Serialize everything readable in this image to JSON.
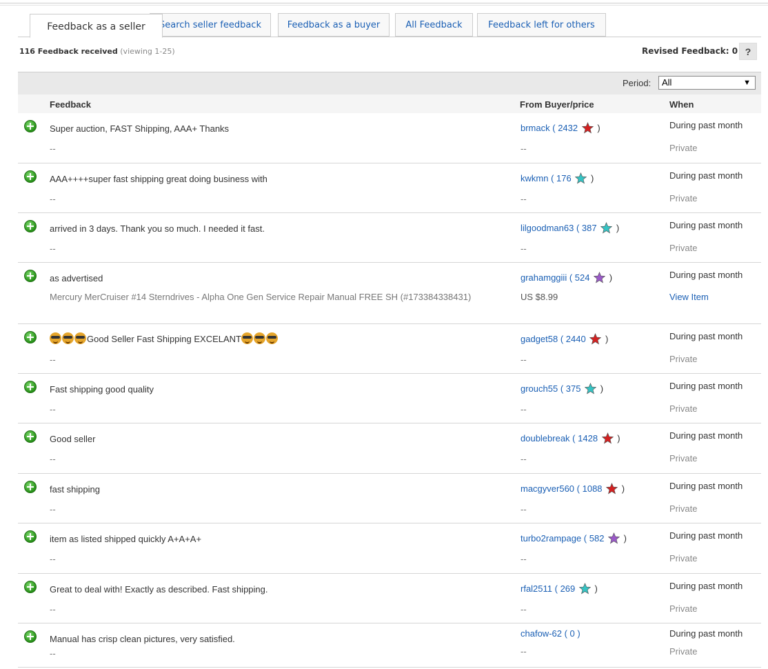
{
  "tabs": [
    {
      "label": "Feedback as a seller"
    },
    {
      "label": "Search seller feedback"
    },
    {
      "label": "Feedback as a buyer"
    },
    {
      "label": "All Feedback"
    },
    {
      "label": "Feedback left for others"
    }
  ],
  "summary": {
    "count_text": "116 Feedback received",
    "viewing_text": "(viewing 1-25)"
  },
  "revised": {
    "label": "Revised Feedback: 0",
    "help": "?"
  },
  "period": {
    "label": "Period:",
    "value": "All"
  },
  "columns": {
    "feedback": "Feedback",
    "from": "From Buyer/price",
    "when": "When"
  },
  "star_colors": {
    "red": "#d42020",
    "teal": "#35c4c4",
    "purple": "#9b59c9"
  },
  "rows": [
    {
      "comment": "Super auction, FAST Shipping, AAA+ Thanks",
      "item": "--",
      "buyer": "brmack",
      "score": "2432",
      "star": "red",
      "price": "--",
      "when": "During past month",
      "status": "Private"
    },
    {
      "comment": "AAA++++super fast shipping great doing business with",
      "item": "--",
      "buyer": "kwkmn",
      "score": "176",
      "star": "teal",
      "price": "--",
      "when": "During past month",
      "status": "Private"
    },
    {
      "comment": "arrived in 3 days. Thank you so much. I needed it fast.",
      "item": "--",
      "buyer": "lilgoodman63",
      "score": "387",
      "star": "teal",
      "price": "--",
      "when": "During past month",
      "status": "Private"
    },
    {
      "comment": "as advertised",
      "item": "Mercury MerCruiser #14 Sterndrives - Alpha One Gen Service Repair Manual FREE SH (#173384338431)",
      "buyer": "grahamggiii",
      "score": "524",
      "star": "purple",
      "price": "US $8.99",
      "when": "During past month",
      "status": "View Item"
    },
    {
      "comment_pre": "",
      "comment": "Good Seller Fast Shipping EXCELANT",
      "item": "--",
      "buyer": "gadget58",
      "score": "2440",
      "star": "red",
      "price": "--",
      "when": "During past month",
      "status": "Private"
    },
    {
      "comment": "Fast shipping good quality",
      "item": "--",
      "buyer": "grouch55",
      "score": "375",
      "star": "teal",
      "price": "--",
      "when": "During past month",
      "status": "Private"
    },
    {
      "comment": "Good seller",
      "item": "--",
      "buyer": "doublebreak",
      "score": "1428",
      "star": "red",
      "price": "--",
      "when": "During past month",
      "status": "Private"
    },
    {
      "comment": "fast shipping",
      "item": "--",
      "buyer": "macgyver560",
      "score": "1088",
      "star": "red",
      "price": "--",
      "when": "During past month",
      "status": "Private"
    },
    {
      "comment": "item as listed shipped quickly A+A+A+",
      "item": "--",
      "buyer": "turbo2rampage",
      "score": "582",
      "star": "purple",
      "price": "--",
      "when": "During past month",
      "status": "Private"
    },
    {
      "comment": "Great to deal with! Exactly as described. Fast shipping.",
      "item": "--",
      "buyer": "rfal2511",
      "score": "269",
      "star": "teal",
      "price": "--",
      "when": "During past month",
      "status": "Private"
    },
    {
      "comment": "Manual has crisp clean pictures, very satisfied.",
      "item": "--",
      "buyer": "chafow-62",
      "score": "0",
      "star": "",
      "price": "--",
      "when": "During past month",
      "status": "Private"
    }
  ]
}
